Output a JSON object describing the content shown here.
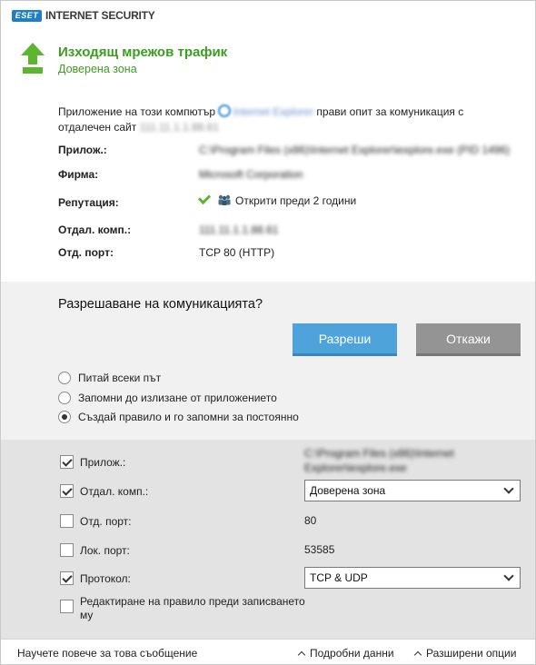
{
  "app": {
    "brand_logo": "ESET",
    "title": "INTERNET SECURITY"
  },
  "header": {
    "title": "Изходящ мрежов трафик",
    "subtitle": "Доверена зона",
    "icon": "arrow-up-icon",
    "accent_color": "#3a9e1f"
  },
  "info": {
    "intro_prefix": "Приложение на този компютър",
    "intro_app": "Internet Explorer",
    "intro_middle": "прави опит за комуникация с отдалечен сайт",
    "intro_site": "111.11.1.1.88.61",
    "rows": [
      {
        "label": "Прилож.:",
        "value": "C:\\Program Files (x86)\\Internet Explorer\\iexplore.exe (PID 1496)"
      },
      {
        "label": "Фирма:",
        "value": "Microsoft Corporation"
      },
      {
        "label": "Репутация:",
        "value": "Открити преди 2 години"
      },
      {
        "label": "Отдал. комп.:",
        "value": "111.11.1.1.88.61"
      },
      {
        "label": "Отд. порт:",
        "value": "TCP 80 (HTTP)"
      }
    ]
  },
  "decision": {
    "question": "Разрешаване на комуникацията?",
    "allow_label": "Разреши",
    "deny_label": "Откажи",
    "allow_color": "#4ea4da",
    "deny_color": "#949494",
    "radio_options": [
      {
        "label": "Питай всеки път",
        "selected": false
      },
      {
        "label": "Запомни до излизане от приложението",
        "selected": false
      },
      {
        "label": "Създай правило и го запомни за постоянно",
        "selected": true
      }
    ]
  },
  "rule_options": [
    {
      "label": "Прилож.:",
      "checked": true,
      "value": "C:\\Program Files (x86)\\Internet Explorer\\iexplore.exe"
    },
    {
      "label": "Отдал. комп.:",
      "checked": true,
      "select": "Доверена зона"
    },
    {
      "label": "Отд. порт:",
      "checked": false,
      "value": "80"
    },
    {
      "label": "Лок. порт:",
      "checked": false,
      "value": "53585"
    },
    {
      "label": "Протокол:",
      "checked": true,
      "select": "TCP & UDP"
    },
    {
      "label": "Редактиране на правило преди записването му",
      "checked": false
    }
  ],
  "footer": {
    "learn_more": "Научете повече за това съобщение",
    "details": "Подробни данни",
    "advanced": "Разширени опции"
  }
}
